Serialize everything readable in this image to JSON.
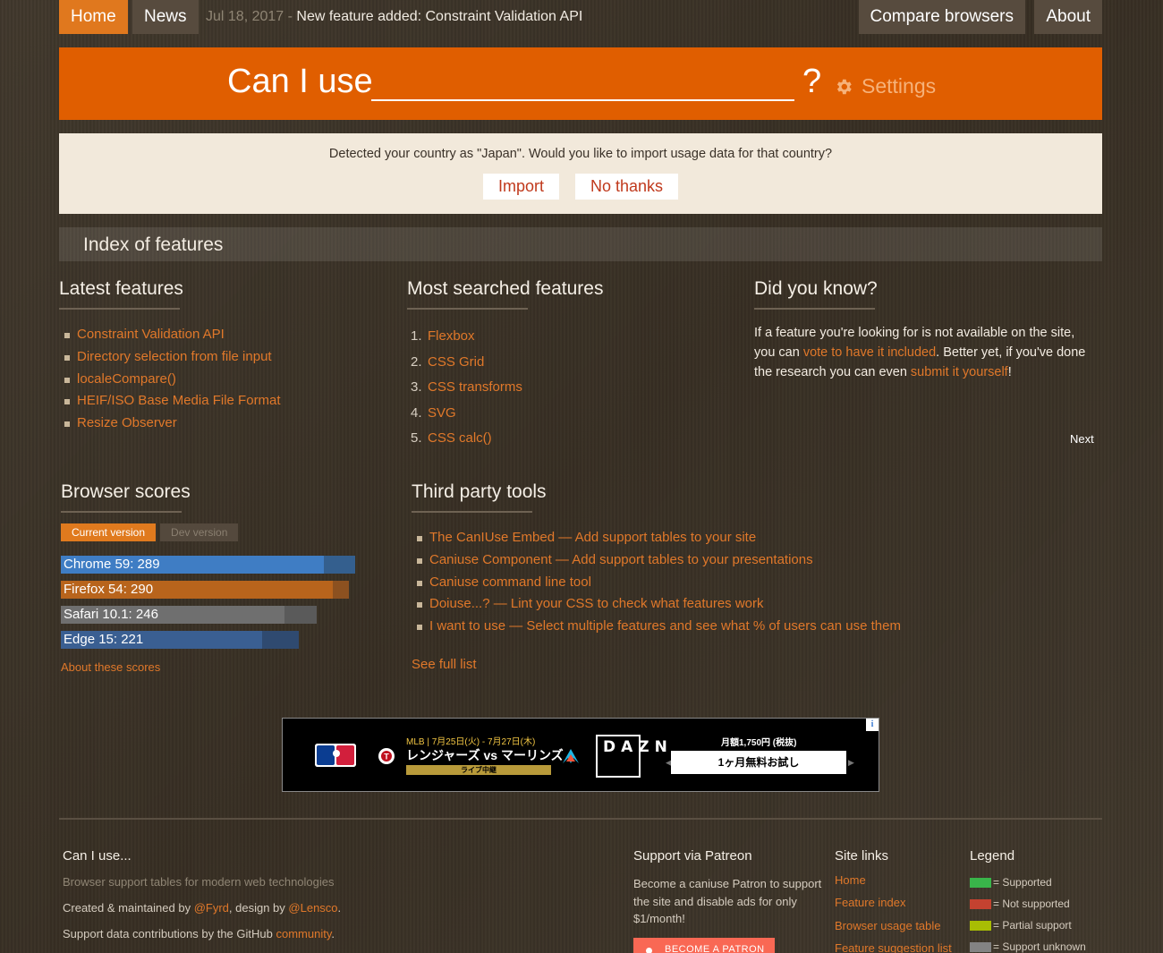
{
  "nav": {
    "home": "Home",
    "news": "News",
    "news_date": "Jul 18, 2017",
    "news_sep": " - ",
    "news_text": "New feature added: Constraint Validation API",
    "compare": "Compare browsers",
    "about": "About"
  },
  "header": {
    "title": "Can I use",
    "question": "?",
    "search_value": "",
    "settings": "Settings"
  },
  "country": {
    "message": "Detected your country as \"Japan\". Would you like to import usage data for that country?",
    "import": "Import",
    "no_thanks": "No thanks"
  },
  "index": {
    "title": "Index of features"
  },
  "latest": {
    "title": "Latest features",
    "items": [
      "Constraint Validation API",
      "Directory selection from file input",
      "localeCompare()",
      "HEIF/ISO Base Media File Format",
      "Resize Observer"
    ]
  },
  "most_searched": {
    "title": "Most searched features",
    "items": [
      {
        "n": "1.",
        "label": "Flexbox"
      },
      {
        "n": "2.",
        "label": "CSS Grid"
      },
      {
        "n": "3.",
        "label": "CSS transforms"
      },
      {
        "n": "4.",
        "label": "SVG"
      },
      {
        "n": "5.",
        "label": "CSS calc()"
      }
    ]
  },
  "did_you_know": {
    "title": "Did you know?",
    "text1": "If a feature you're looking for is not available on the site, you can ",
    "link1": "vote to have it included",
    "text2": ". Better yet, if you've done the research you can even ",
    "link2": "submit it yourself",
    "text3": "!",
    "next": "Next"
  },
  "browser_scores": {
    "title": "Browser scores",
    "tab_current": "Current version",
    "tab_dev": "Dev version",
    "scores": [
      {
        "label": "Chrome 59: 289",
        "fill": 0.894,
        "max": 1.0,
        "color": "#3f7dc4",
        "track": "#345f8e"
      },
      {
        "label": "Firefox 54: 290",
        "fill": 0.925,
        "max": 0.98,
        "color": "#b8641c",
        "track": "#8c5120"
      },
      {
        "label": "Safari 10.1: 246",
        "fill": 0.76,
        "max": 0.87,
        "color": "#6f6f6f",
        "track": "#5a5a5a"
      },
      {
        "label": "Edge 15: 221",
        "fill": 0.685,
        "max": 0.81,
        "color": "#3a5f92",
        "track": "#2f4a70"
      }
    ],
    "about": "About these scores"
  },
  "third_party": {
    "title": "Third party tools",
    "items": [
      "The CanIUse Embed — Add support tables to your site",
      "Caniuse Component — Add support tables to your presentations",
      "Caniuse command line tool",
      "Doiuse...? — Lint your CSS to check what features work",
      "I want to use — Select multiple features and see what % of users can use them"
    ],
    "see_full": "See full list"
  },
  "ad": {
    "info": "i",
    "date": "MLB | 7月25日(火) - 7月27日(木)",
    "match": "レンジャーズ vs マーリンズ",
    "live": "ライブ中継",
    "brand": "DAZN",
    "price": "月額1,750円 (税抜)",
    "cta": "1ヶ月無料お試し"
  },
  "footer": {
    "title": "Can I use...",
    "tagline": "Browser support tables for modern web technologies",
    "created_prefix": "Created & maintained by ",
    "created_link": "@Fyrd",
    "created_mid": ", design by ",
    "design_link": "@Lensco",
    "created_suffix": ".",
    "support_prefix": "Support data contributions by the GitHub ",
    "support_link": "community",
    "support_suffix": ".",
    "patreon_title": "Support via Patreon",
    "patreon_text": "Become a caniuse Patron to support the site and disable ads for only $1/month!",
    "patreon_btn": "BECOME A PATRON",
    "site_links_title": "Site links",
    "site_links": [
      "Home",
      "Feature index",
      "Browser usage table",
      "Feature suggestion list"
    ],
    "legend_title": "Legend",
    "legend": [
      {
        "label": "= Supported",
        "color": "#39b54a"
      },
      {
        "label": "= Not supported",
        "color": "#c44230"
      },
      {
        "label": "= Partial support",
        "color": "#a8bd04"
      },
      {
        "label": "= Support unknown",
        "color": "#838383"
      }
    ]
  }
}
